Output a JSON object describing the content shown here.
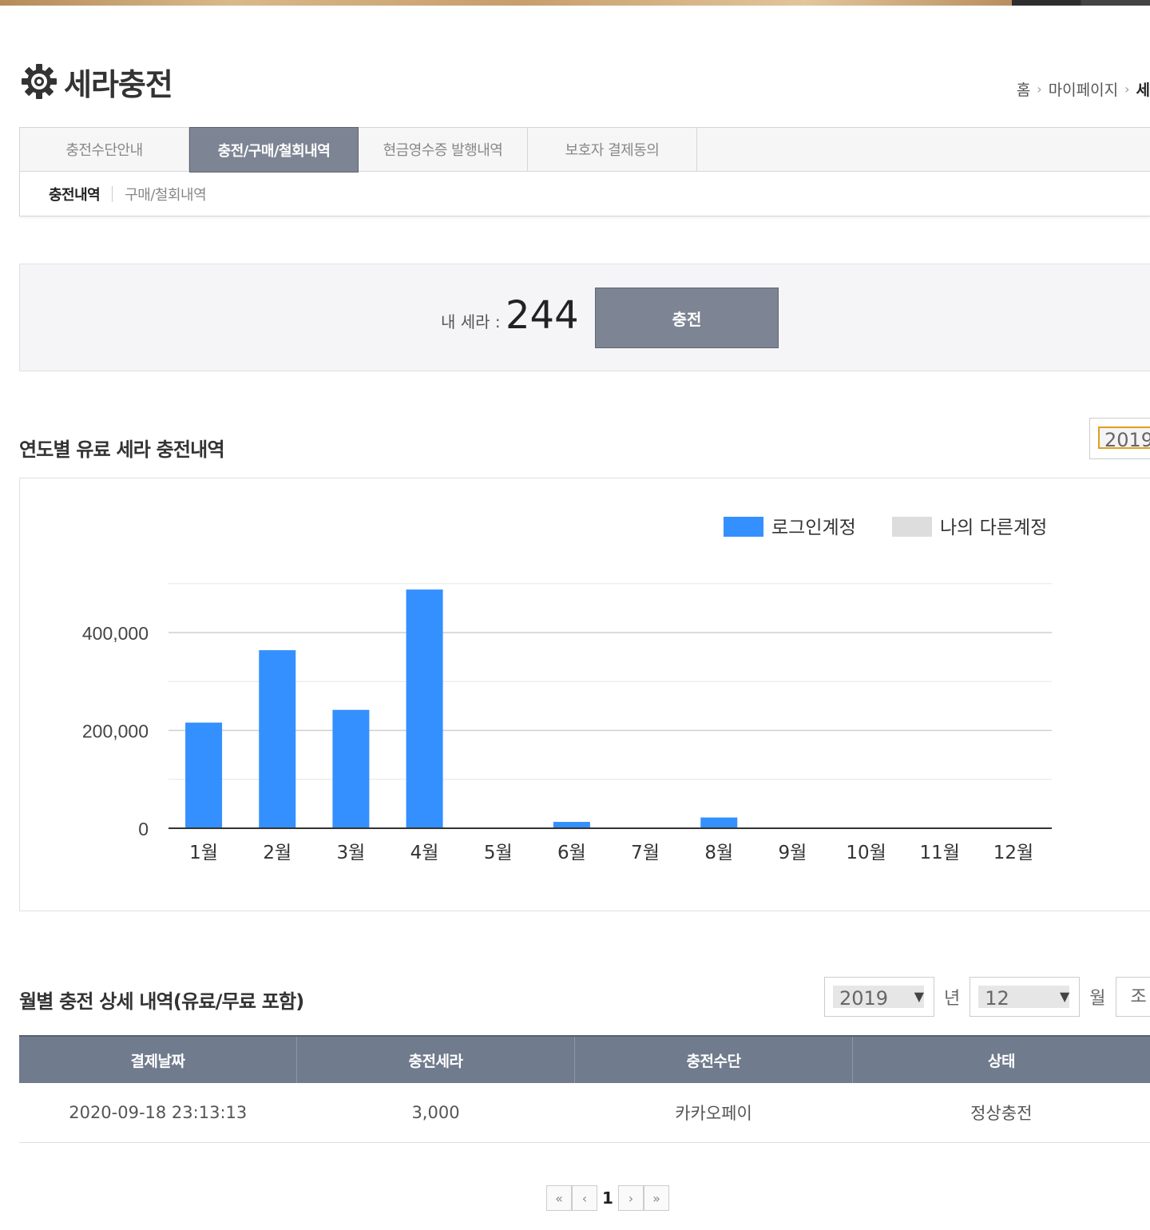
{
  "header": {
    "title": "세라충전",
    "icon": "gear-icon"
  },
  "breadcrumb": {
    "home": "홈",
    "mypage": "마이페이지",
    "cut": "세"
  },
  "tabs": [
    {
      "label": "충전수단안내",
      "active": false
    },
    {
      "label": "충전/구매/철회내역",
      "active": true
    },
    {
      "label": "현금영수증 발행내역",
      "active": false
    },
    {
      "label": "보호자 결제동의",
      "active": false
    }
  ],
  "subtabs": [
    {
      "label": "충전내역",
      "active": true
    },
    {
      "label": "구매/철회내역",
      "active": false
    }
  ],
  "balance": {
    "label": "내 세라 :",
    "value": "244",
    "charge_button": "충전"
  },
  "yearly": {
    "title": "연도별 유료 세라 충전내역",
    "year_select": "2019"
  },
  "chart_data": {
    "type": "bar",
    "categories": [
      "1월",
      "2월",
      "3월",
      "4월",
      "5월",
      "6월",
      "7월",
      "8월",
      "9월",
      "10월",
      "11월",
      "12월"
    ],
    "series": [
      {
        "name": "로그인계정",
        "color": "#3590ff",
        "values": [
          216000,
          364000,
          242000,
          488000,
          0,
          13000,
          0,
          22000,
          0,
          0,
          0,
          0
        ]
      },
      {
        "name": "나의 다른계정",
        "color": "#dddddd",
        "values": [
          0,
          0,
          0,
          0,
          0,
          0,
          0,
          0,
          0,
          0,
          0,
          0
        ]
      }
    ],
    "yticks": [
      "0",
      "200,000",
      "400,000"
    ],
    "ylim": [
      0,
      500000
    ],
    "grid": true,
    "legend": "top-right"
  },
  "monthly": {
    "title": "월별 충전 상세 내역(유료/무료 포함)",
    "year": "2019",
    "year_unit": "년",
    "month": "12",
    "month_unit": "월",
    "search_cut": "조"
  },
  "table": {
    "headers": [
      "결제날짜",
      "충전세라",
      "충전수단",
      "상태"
    ],
    "rows": [
      [
        "2020-09-18 23:13:13",
        "3,000",
        "카카오페이",
        "정상충전"
      ]
    ]
  },
  "pagination": {
    "first": "«",
    "prev": "‹",
    "current": "1",
    "next": "›",
    "last": "»"
  }
}
